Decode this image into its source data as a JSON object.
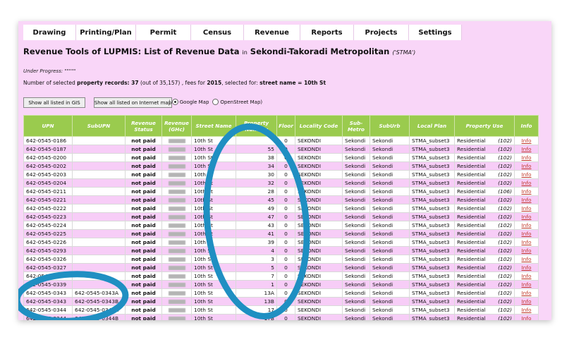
{
  "tabs": [
    "Drawing",
    "Printing/Plan",
    "Permit",
    "Census",
    "Revenue",
    "Reports",
    "Projects",
    "Settings"
  ],
  "page": {
    "title_main": "Revenue Tools of LUPMIS: List of Revenue Data",
    "title_in": "in",
    "title_place": "Sekondi-Takoradi Metropolitan",
    "title_code": "('STMA')",
    "progress": "Under Progress: \"\"\"\"\"",
    "records_pre": "Number of selected ",
    "records_b1": "property records: 37",
    "records_mid1": " (out of 35,157) , fees for ",
    "records_b2": "2015",
    "records_mid2": ", selected for: ",
    "records_b3": "street name = 10th St"
  },
  "buttons": {
    "gis": "Show all listed in GIS",
    "map": "Show all listed on Internet map"
  },
  "map_options": {
    "open": "(",
    "google": "Google Map",
    "osm": "OpenStreet Map)"
  },
  "table": {
    "headers": [
      "UPN",
      "SubUPN",
      "Revenue Status",
      "Revenue (GHc)",
      "Street Name",
      "Property Number",
      "Floor",
      "Locality Code",
      "Sub-Metro",
      "SubUrb",
      "Local Plan",
      "Property Use",
      "Info"
    ],
    "rows": [
      {
        "upn": "642-0545-0186",
        "sub": "",
        "status": "not paid",
        "street": "10th St",
        "num": "",
        "floor": "0",
        "loc": "SEKONDI",
        "metro": "Sekondi",
        "suburb": "Sekondi",
        "plan": "STMA_subset3",
        "use": "Residential",
        "code": "(102)",
        "info": "Info"
      },
      {
        "upn": "642-0545-0187",
        "sub": "",
        "status": "not paid",
        "street": "10th St",
        "num": "55",
        "floor": "0",
        "loc": "SEKONDI",
        "metro": "Sekondi",
        "suburb": "Sekondi",
        "plan": "STMA_subset3",
        "use": "Residential",
        "code": "(102)",
        "info": "Info"
      },
      {
        "upn": "642-0545-0200",
        "sub": "",
        "status": "not paid",
        "street": "10th St",
        "num": "38",
        "floor": "0",
        "loc": "SEKONDI",
        "metro": "Sekondi",
        "suburb": "Sekondi",
        "plan": "STMA_subset3",
        "use": "Residential",
        "code": "(102)",
        "info": "Info"
      },
      {
        "upn": "642-0545-0202",
        "sub": "",
        "status": "not paid",
        "street": "10th St",
        "num": "34",
        "floor": "0",
        "loc": "SEKONDI",
        "metro": "Sekondi",
        "suburb": "Sekondi",
        "plan": "STMA_subset3",
        "use": "Residential",
        "code": "(102)",
        "info": "Info"
      },
      {
        "upn": "642-0545-0203",
        "sub": "",
        "status": "not paid",
        "street": "10th St",
        "num": "30",
        "floor": "0",
        "loc": "SEKONDI",
        "metro": "Sekondi",
        "suburb": "Sekondi",
        "plan": "STMA_subset3",
        "use": "Residential",
        "code": "(102)",
        "info": "Info"
      },
      {
        "upn": "642-0545-0204",
        "sub": "",
        "status": "not paid",
        "street": "10th St",
        "num": "32",
        "floor": "0",
        "loc": "SEKONDI",
        "metro": "Sekondi",
        "suburb": "Sekondi",
        "plan": "STMA_subset3",
        "use": "Residential",
        "code": "(102)",
        "info": "Info"
      },
      {
        "upn": "642-0545-0211",
        "sub": "",
        "status": "not paid",
        "street": "10th St",
        "num": "28",
        "floor": "0",
        "loc": "SEKONDI",
        "metro": "Sekondi",
        "suburb": "Sekondi",
        "plan": "STMA_subset3",
        "use": "Residential",
        "code": "(106)",
        "info": "Info"
      },
      {
        "upn": "642-0545-0221",
        "sub": "",
        "status": "not paid",
        "street": "10th St",
        "num": "45",
        "floor": "0",
        "loc": "SEKONDI",
        "metro": "Sekondi",
        "suburb": "Sekondi",
        "plan": "STMA_subset3",
        "use": "Residential",
        "code": "(102)",
        "info": "Info"
      },
      {
        "upn": "642-0545-0222",
        "sub": "",
        "status": "not paid",
        "street": "10th St",
        "num": "49",
        "floor": "0",
        "loc": "SEKONDI",
        "metro": "Sekondi",
        "suburb": "Sekondi",
        "plan": "STMA_subset3",
        "use": "Residential",
        "code": "(102)",
        "info": "Info"
      },
      {
        "upn": "642-0545-0223",
        "sub": "",
        "status": "not paid",
        "street": "10th St",
        "num": "47",
        "floor": "0",
        "loc": "SEKONDI",
        "metro": "Sekondi",
        "suburb": "Sekondi",
        "plan": "STMA_subset3",
        "use": "Residential",
        "code": "(102)",
        "info": "Info"
      },
      {
        "upn": "642-0545-0224",
        "sub": "",
        "status": "not paid",
        "street": "10th St",
        "num": "43",
        "floor": "0",
        "loc": "SEKONDI",
        "metro": "Sekondi",
        "suburb": "Sekondi",
        "plan": "STMA_subset3",
        "use": "Residential",
        "code": "(102)",
        "info": "Info"
      },
      {
        "upn": "642-0545-0225",
        "sub": "",
        "status": "not paid",
        "street": "10th St",
        "num": "41",
        "floor": "0",
        "loc": "SEKONDI",
        "metro": "Sekondi",
        "suburb": "Sekondi",
        "plan": "STMA_subset3",
        "use": "Residential",
        "code": "(102)",
        "info": "Info"
      },
      {
        "upn": "642-0545-0226",
        "sub": "",
        "status": "not paid",
        "street": "10th St",
        "num": "39",
        "floor": "0",
        "loc": "SEKONDI",
        "metro": "Sekondi",
        "suburb": "Sekondi",
        "plan": "STMA_subset3",
        "use": "Residential",
        "code": "(102)",
        "info": "Info"
      },
      {
        "upn": "642-0545-0293",
        "sub": "",
        "status": "not paid",
        "street": "10th St",
        "num": "4",
        "floor": "0",
        "loc": "SEKONDI",
        "metro": "Sekondi",
        "suburb": "Sekondi",
        "plan": "STMA_subset3",
        "use": "Residential",
        "code": "(102)",
        "info": "Info"
      },
      {
        "upn": "642-0545-0326",
        "sub": "",
        "status": "not paid",
        "street": "10th St",
        "num": "3",
        "floor": "0",
        "loc": "SEKONDI",
        "metro": "Sekondi",
        "suburb": "Sekondi",
        "plan": "STMA_subset3",
        "use": "Residential",
        "code": "(102)",
        "info": "Info"
      },
      {
        "upn": "642-0545-0327",
        "sub": "",
        "status": "not paid",
        "street": "10th St",
        "num": "5",
        "floor": "0",
        "loc": "SEKONDI",
        "metro": "Sekondi",
        "suburb": "Sekondi",
        "plan": "STMA_subset3",
        "use": "Residential",
        "code": "(102)",
        "info": "Info"
      },
      {
        "upn": "642-0545-0337",
        "sub": "",
        "status": "not paid",
        "street": "10th St",
        "num": "7",
        "floor": "0",
        "loc": "SEKONDI",
        "metro": "Sekondi",
        "suburb": "Sekondi",
        "plan": "STMA_subset3",
        "use": "Residential",
        "code": "(102)",
        "info": "Info"
      },
      {
        "upn": "642-0545-0339",
        "sub": "",
        "status": "not paid",
        "street": "10th St",
        "num": "1",
        "floor": "0",
        "loc": "SEKONDI",
        "metro": "Sekondi",
        "suburb": "Sekondi",
        "plan": "STMA_subset3",
        "use": "Residential",
        "code": "(102)",
        "info": "Info"
      },
      {
        "upn": "642-0545-0343",
        "sub": "642-0545-0343A",
        "status": "not paid",
        "street": "10th St",
        "num": "13A",
        "floor": "0",
        "loc": "SEKONDI",
        "metro": "Sekondi",
        "suburb": "Sekondi",
        "plan": "STMA_subset3",
        "use": "Residential",
        "code": "(102)",
        "info": "Info"
      },
      {
        "upn": "642-0545-0343",
        "sub": "642-0545-0343B",
        "status": "not paid",
        "street": "10th St",
        "num": "13B",
        "floor": "0",
        "loc": "SEKONDI",
        "metro": "Sekondi",
        "suburb": "Sekondi",
        "plan": "STMA_subset3",
        "use": "Residential",
        "code": "(102)",
        "info": "Info"
      },
      {
        "upn": "642-0545-0344",
        "sub": "642-0545-0344A",
        "status": "not paid",
        "street": "10th St",
        "num": "17",
        "floor": "0",
        "loc": "SEKONDI",
        "metro": "Sekondi",
        "suburb": "Sekondi",
        "plan": "STMA_subset3",
        "use": "Residential",
        "code": "(102)",
        "info": "Info"
      },
      {
        "upn": "642-0545-0344",
        "sub": "642-0545-0344B",
        "status": "not paid",
        "street": "10th St",
        "num": "17B",
        "floor": "0",
        "loc": "SEKONDI",
        "metro": "Sekondi",
        "suburb": "Sekondi",
        "plan": "STMA_subset3",
        "use": "Residential",
        "code": "(102)",
        "info": "Info"
      }
    ]
  },
  "colors": {
    "page_bg": "#f9d6f8",
    "header_green": "#9acb4e",
    "highlight_blue": "#1f8fc2",
    "link_red": "#c0392b"
  }
}
